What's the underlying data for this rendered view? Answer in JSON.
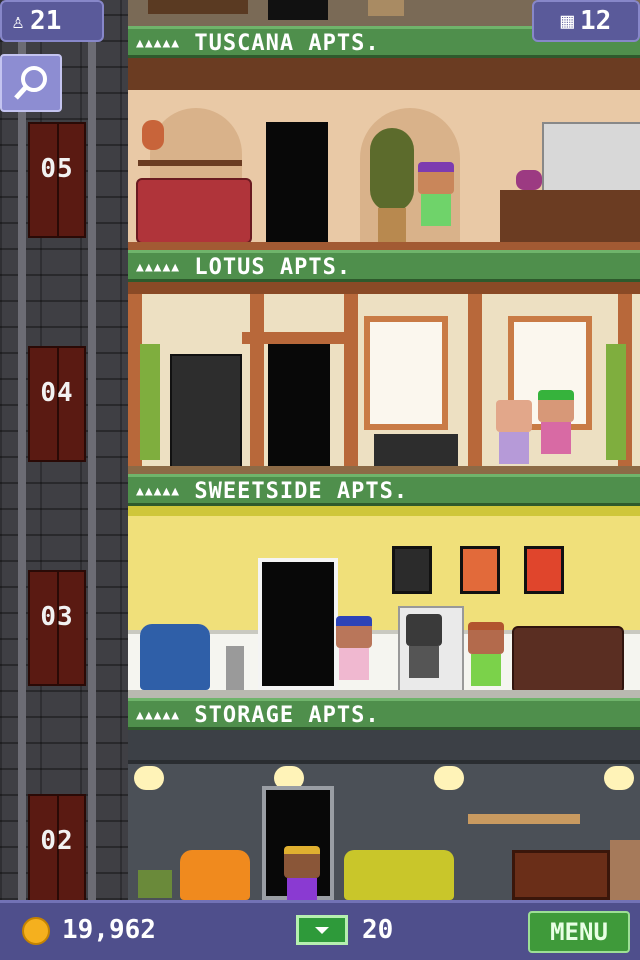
{
  "hud": {
    "population_count": "21",
    "floor_count": "12",
    "coins": "19,962",
    "bux": "20",
    "menu_label": "MENU"
  },
  "icons": {
    "population": "people-icon",
    "floors": "building-icon",
    "search": "magnifier-icon",
    "coin": "coin-icon",
    "bux": "bux-cash-icon"
  },
  "floors": [
    {
      "number": "05",
      "name": "TUSCANA APTS.",
      "stars": "▲▲▲▲▲",
      "theme_color": "#e9c9a6"
    },
    {
      "number": "04",
      "name": "LOTUS APTS.",
      "stars": "▲▲▲▲▲",
      "theme_color": "#ede0c2"
    },
    {
      "number": "03",
      "name": "SWEETSIDE APTS.",
      "stars": "▲▲▲▲▲",
      "theme_color": "#f0e07a"
    },
    {
      "number": "02",
      "name": "STORAGE APTS.",
      "stars": "▲▲▲▲▲",
      "theme_color": "#4b5057"
    }
  ],
  "colors": {
    "roof_green": "#4f8f4c",
    "hud_purple": "#4f4f8c",
    "menu_green": "#3f9a3a",
    "elevator_door": "#5a1a12"
  }
}
